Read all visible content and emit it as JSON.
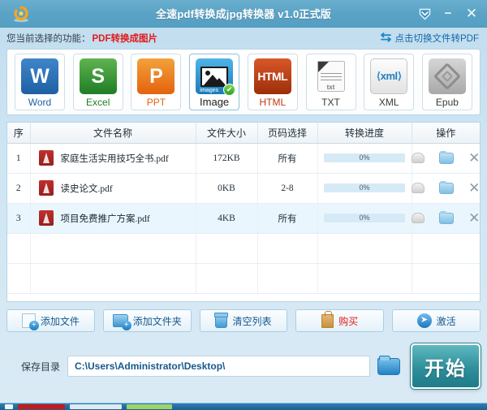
{
  "window": {
    "title": "全速pdf转换成jpg转换器 v1.0正式版",
    "app_icon": "refresh-circle-icon",
    "controls": {
      "dropdown": "chevron-down-badge-icon",
      "minimize": "−",
      "close": "✕"
    }
  },
  "funcbar": {
    "label": "您当前选择的功能：",
    "value": "PDF转换成图片",
    "switch_icon": "swap-arrows-icon",
    "switch_label": "点击切换文件转PDF",
    "accent_red": "#e01b1b",
    "accent_blue": "#1568a8"
  },
  "formats": [
    {
      "id": "word",
      "caption": "Word",
      "glyph": "W",
      "selected": false
    },
    {
      "id": "excel",
      "caption": "Excel",
      "glyph": "S",
      "selected": false
    },
    {
      "id": "ppt",
      "caption": "PPT",
      "glyph": "P",
      "selected": false
    },
    {
      "id": "image",
      "caption": "Image",
      "glyph": "images",
      "selected": true
    },
    {
      "id": "html",
      "caption": "HTML",
      "glyph": "HTML",
      "selected": false
    },
    {
      "id": "txt",
      "caption": "TXT",
      "glyph": "txt",
      "selected": false
    },
    {
      "id": "xml",
      "caption": "XML",
      "glyph": "xml",
      "selected": false
    },
    {
      "id": "epub",
      "caption": "Epub",
      "glyph": "",
      "selected": false
    }
  ],
  "table": {
    "headers": [
      "序",
      "文件名称",
      "文件大小",
      "页码选择",
      "转换进度",
      "操作"
    ],
    "rows": [
      {
        "index": "1",
        "name": "家庭生活实用技巧全书.pdf",
        "size": "172KB",
        "pages": "所有",
        "progress": "0%",
        "progress_value": 0
      },
      {
        "index": "2",
        "name": "读史论文.pdf",
        "size": "0KB",
        "pages": "2-8",
        "progress": "0%",
        "progress_value": 0
      },
      {
        "index": "3",
        "name": "项目免费推广方案.pdf",
        "size": "4KB",
        "pages": "所有",
        "progress": "0%",
        "progress_value": 0
      }
    ],
    "ops": {
      "preview": "preview-icon",
      "open_folder": "folder-icon",
      "remove": "✕"
    }
  },
  "actions": [
    {
      "id": "add-file",
      "label": "添加文件",
      "icon": "add-file-icon",
      "red": false
    },
    {
      "id": "add-folder",
      "label": "添加文件夹",
      "icon": "add-folder-icon",
      "red": false
    },
    {
      "id": "clear-list",
      "label": "清空列表",
      "icon": "trash-icon",
      "red": false
    },
    {
      "id": "buy",
      "label": "购买",
      "icon": "shopping-bag-icon",
      "red": true
    },
    {
      "id": "activate",
      "label": "激活",
      "icon": "arrow-right-icon",
      "red": false
    }
  ],
  "save": {
    "label": "保存目录",
    "path": "C:\\Users\\Administrator\\Desktop\\",
    "placeholder": "C:\\Users\\Administrator\\Desktop\\",
    "browse_icon": "folder-browse-icon",
    "start_label": "开始"
  }
}
